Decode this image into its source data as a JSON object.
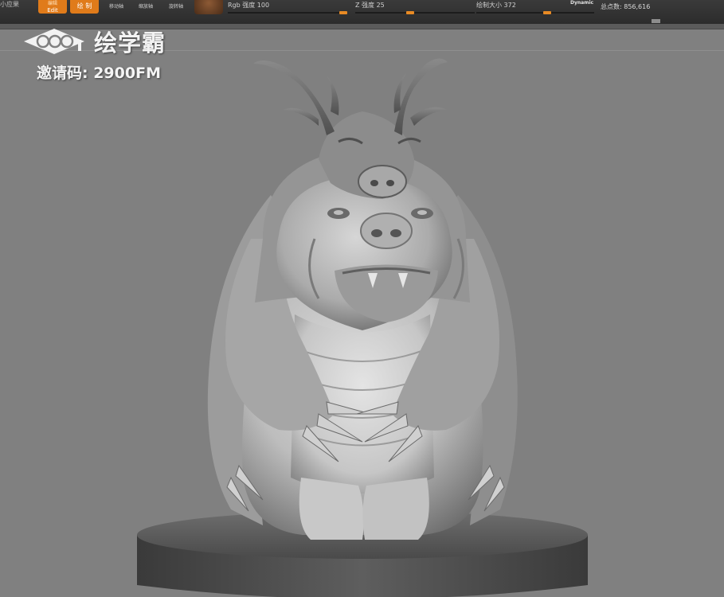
{
  "toolbar": {
    "truncated_text": "小应果",
    "edit_button": {
      "top": "编辑",
      "label": "Edit"
    },
    "draw_button": {
      "label": "绘 制"
    },
    "tools": [
      "移动轴",
      "缩放轴",
      "旋转轴"
    ],
    "rgb_intensity": {
      "label": "Rgb 强度 100",
      "value": 100
    },
    "z_intensity": {
      "label": "Z 强度 25",
      "value": 25
    },
    "draw_size": {
      "label": "绘制大小 372",
      "value": 372
    },
    "dynamic_label": "Dynamic",
    "total_points": "总点数: 856,616"
  },
  "watermark": {
    "brand": "绘学霸",
    "invite": "邀请码: 2900FM"
  },
  "colors": {
    "viewport": "#808080",
    "accent": "#e07b1a",
    "clay": "#c9c9c9"
  }
}
